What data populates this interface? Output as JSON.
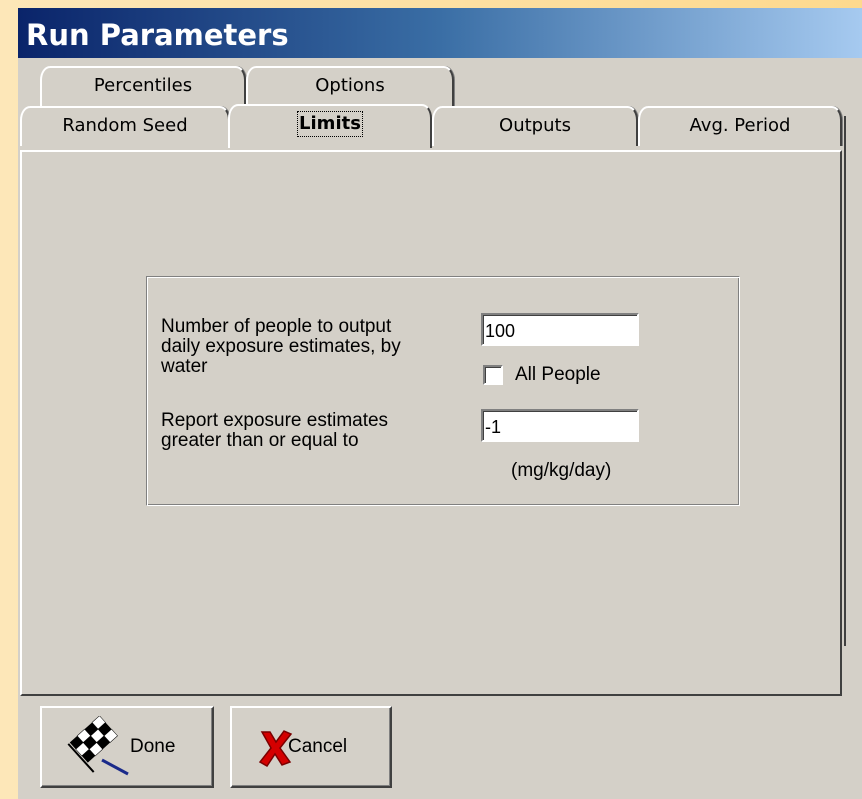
{
  "window": {
    "title": "Run Parameters"
  },
  "tabs": {
    "row_back": [
      "Percentiles",
      "Options"
    ],
    "row_front": [
      "Random Seed",
      "Limits",
      "Outputs",
      "Avg. Period"
    ],
    "active": "Limits"
  },
  "limits": {
    "people_label_line1": "Number of people to output",
    "people_label_line2": "daily exposure estimates, by",
    "people_label_line3": "water",
    "people_value": "100",
    "all_people_label": "All People",
    "all_people_checked": false,
    "report_label_line1": "Report exposure estimates",
    "report_label_line2": "greater than or equal to",
    "report_value": "-1",
    "units": "(mg/kg/day)"
  },
  "buttons": {
    "done_label": "Done",
    "cancel_label": "Cancel"
  },
  "icons": {
    "done": "checkered-flag-icon",
    "cancel": "red-x-icon"
  }
}
